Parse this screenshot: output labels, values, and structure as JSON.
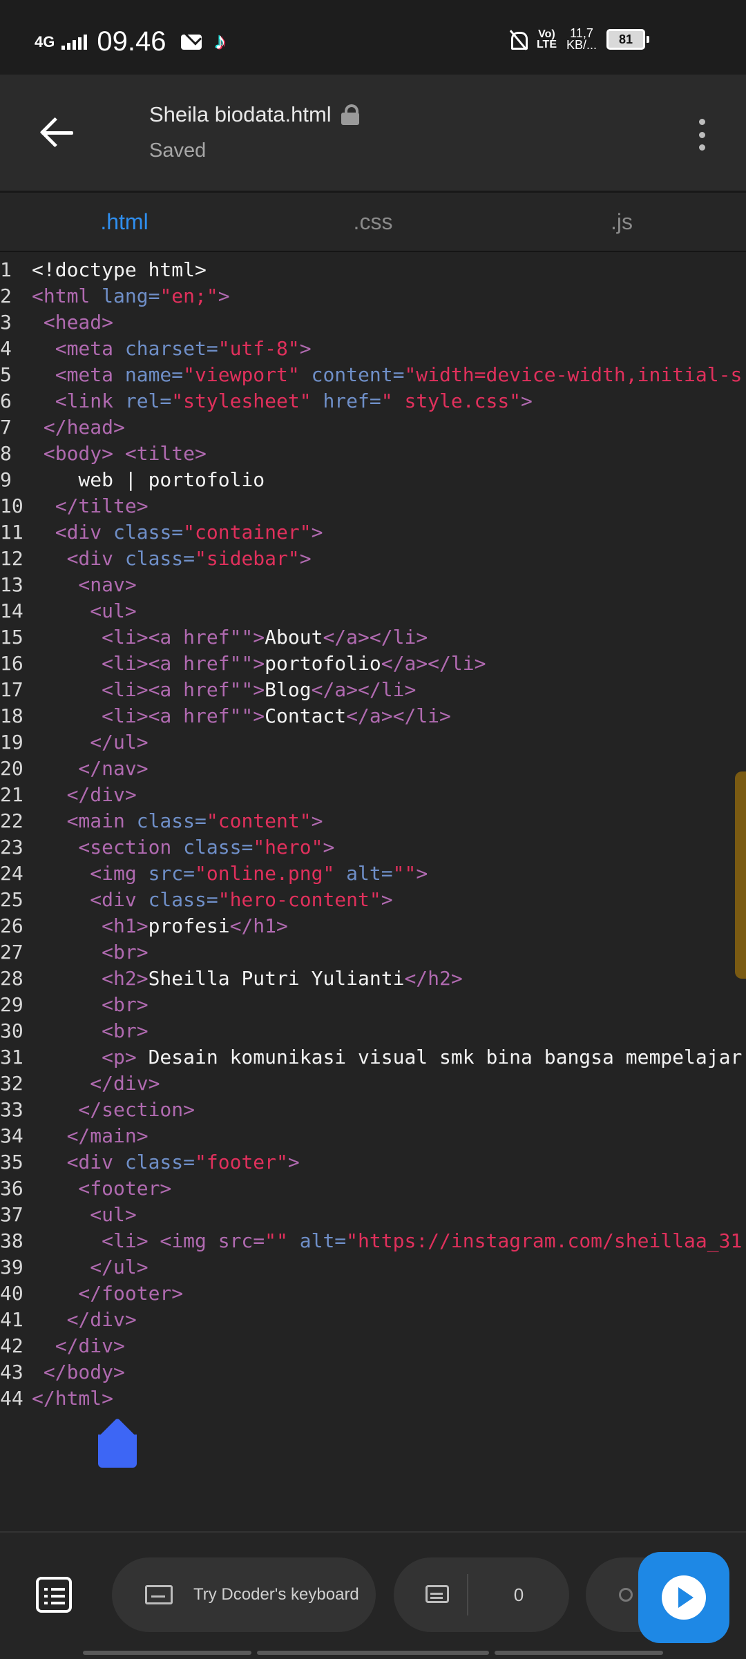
{
  "status_bar": {
    "network": "4G",
    "time": "09.46",
    "volte_top": "Vo)",
    "volte_bottom": "LTE",
    "speed_top": "11,7",
    "speed_bottom": "KB/...",
    "battery": "81"
  },
  "header": {
    "title": "Sheila biodata.html",
    "status": "Saved"
  },
  "tabs": [
    {
      "label": ".html",
      "active": true
    },
    {
      "label": ".css",
      "active": false
    },
    {
      "label": ".js",
      "active": false
    }
  ],
  "code_lines": [
    [
      [
        "txt",
        "<!doctype html>"
      ]
    ],
    [
      [
        "tag",
        "<html "
      ],
      [
        "attr",
        "lang="
      ],
      [
        "str",
        "\"en;\""
      ],
      [
        "tag",
        ">"
      ]
    ],
    [
      [
        "tag",
        " <head>"
      ]
    ],
    [
      [
        "tag",
        "  <meta "
      ],
      [
        "attr",
        "charset="
      ],
      [
        "str",
        "\"utf-8\""
      ],
      [
        "tag",
        ">"
      ]
    ],
    [
      [
        "tag",
        "  <meta "
      ],
      [
        "attr",
        "name="
      ],
      [
        "str",
        "\"viewport\""
      ],
      [
        "attr",
        " content="
      ],
      [
        "str",
        "\"width=device-width,initial-s"
      ]
    ],
    [
      [
        "tag",
        "  <link "
      ],
      [
        "attr",
        "rel="
      ],
      [
        "str",
        "\"stylesheet\""
      ],
      [
        "attr",
        " href="
      ],
      [
        "str",
        "\" style.css\""
      ],
      [
        "tag",
        ">"
      ]
    ],
    [
      [
        "tag",
        " </head>"
      ]
    ],
    [
      [
        "tag",
        " <body> <tilte>"
      ]
    ],
    [
      [
        "txt",
        "    web | portofolio"
      ]
    ],
    [
      [
        "tag",
        "  </tilte>"
      ]
    ],
    [
      [
        "tag",
        "  <div "
      ],
      [
        "attr",
        "class="
      ],
      [
        "str",
        "\"container\""
      ],
      [
        "tag",
        ">"
      ]
    ],
    [
      [
        "tag",
        "   <div "
      ],
      [
        "attr",
        "class="
      ],
      [
        "str",
        "\"sidebar\""
      ],
      [
        "tag",
        ">"
      ]
    ],
    [
      [
        "tag",
        "    <nav>"
      ]
    ],
    [
      [
        "tag",
        "     <ul>"
      ]
    ],
    [
      [
        "tag",
        "      <li><a href\"\">"
      ],
      [
        "txt",
        "About"
      ],
      [
        "tag",
        "</a></li>"
      ]
    ],
    [
      [
        "tag",
        "      <li><a href\"\">"
      ],
      [
        "txt",
        "portofolio"
      ],
      [
        "tag",
        "</a></li>"
      ]
    ],
    [
      [
        "tag",
        "      <li><a href\"\">"
      ],
      [
        "txt",
        "Blog"
      ],
      [
        "tag",
        "</a></li>"
      ]
    ],
    [
      [
        "tag",
        "      <li><a href\"\">"
      ],
      [
        "txt",
        "Contact"
      ],
      [
        "tag",
        "</a></li>"
      ]
    ],
    [
      [
        "tag",
        "     </ul>"
      ]
    ],
    [
      [
        "tag",
        "    </nav>"
      ]
    ],
    [
      [
        "tag",
        "   </div>"
      ]
    ],
    [
      [
        "tag",
        "   <main "
      ],
      [
        "attr",
        "class="
      ],
      [
        "str",
        "\"content\""
      ],
      [
        "tag",
        ">"
      ]
    ],
    [
      [
        "tag",
        "    <section "
      ],
      [
        "attr",
        "class="
      ],
      [
        "str",
        "\"hero\""
      ],
      [
        "tag",
        ">"
      ]
    ],
    [
      [
        "tag",
        "     <img "
      ],
      [
        "attr",
        "src="
      ],
      [
        "str",
        "\"online.png\""
      ],
      [
        "attr",
        " alt="
      ],
      [
        "str",
        "\"\""
      ],
      [
        "tag",
        ">"
      ]
    ],
    [
      [
        "tag",
        "     <div "
      ],
      [
        "attr",
        "class="
      ],
      [
        "str",
        "\"hero-content\""
      ],
      [
        "tag",
        ">"
      ]
    ],
    [
      [
        "tag",
        "      <h1>"
      ],
      [
        "txt",
        "profesi"
      ],
      [
        "tag",
        "</h1>"
      ]
    ],
    [
      [
        "tag",
        "      <br>"
      ]
    ],
    [
      [
        "tag",
        "      <h2>"
      ],
      [
        "txt",
        "Sheilla Putri Yulianti"
      ],
      [
        "tag",
        "</h2>"
      ]
    ],
    [
      [
        "tag",
        "      <br>"
      ]
    ],
    [
      [
        "tag",
        "      <br>"
      ]
    ],
    [
      [
        "tag",
        "      <p>"
      ],
      [
        "txt",
        " Desain komunikasi visual smk bina bangsa mempelajar"
      ]
    ],
    [
      [
        "tag",
        "     </div>"
      ]
    ],
    [
      [
        "tag",
        "    </section>"
      ]
    ],
    [
      [
        "tag",
        "   </main>"
      ]
    ],
    [
      [
        "tag",
        "   <div "
      ],
      [
        "attr",
        "class="
      ],
      [
        "str",
        "\"footer\""
      ],
      [
        "tag",
        ">"
      ]
    ],
    [
      [
        "tag",
        "    <footer>"
      ]
    ],
    [
      [
        "tag",
        "     <ul>"
      ]
    ],
    [
      [
        "tag",
        "      <li> <img src="
      ],
      [
        "str",
        "\"\""
      ],
      [
        "attr",
        " alt="
      ],
      [
        "str",
        "\"https://instagram.com/sheillaa_31"
      ]
    ],
    [
      [
        "tag",
        "     </ul>"
      ]
    ],
    [
      [
        "tag",
        "    </footer>"
      ]
    ],
    [
      [
        "tag",
        "   </div>"
      ]
    ],
    [
      [
        "tag",
        "  </div>"
      ]
    ],
    [
      [
        "tag",
        " </body>"
      ]
    ],
    [
      [
        "tag",
        "</html>"
      ]
    ]
  ],
  "bottom_bar": {
    "keyboard_label": "Try Dcoder's keyboard",
    "comment_count": "0"
  },
  "colors": {
    "accent": "#2f8ff0",
    "run_button": "#1e88e5",
    "tag": "#b06ab0",
    "attribute": "#6f8fc8",
    "string": "#e0305c"
  }
}
